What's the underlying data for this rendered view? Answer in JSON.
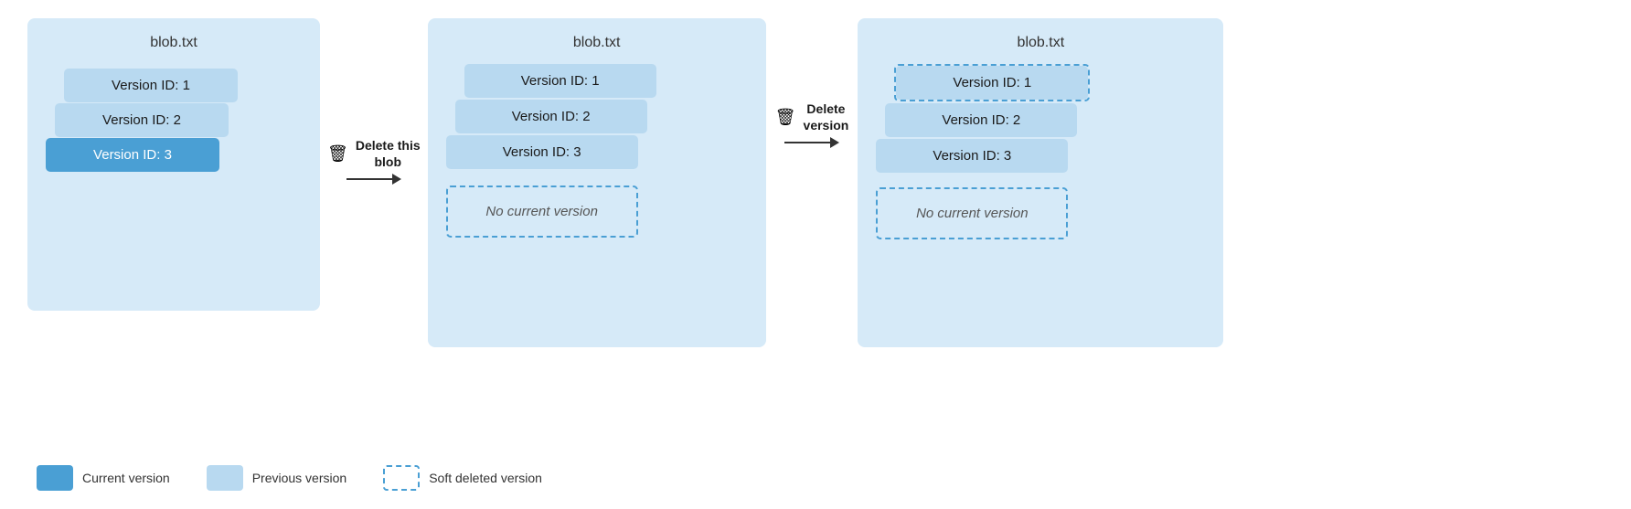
{
  "diagrams": [
    {
      "id": "diagram1",
      "title": "blob.txt",
      "versions": [
        {
          "id": "v1",
          "label": "Version ID: 1",
          "type": "previous"
        },
        {
          "id": "v2",
          "label": "Version ID: 2",
          "type": "previous"
        },
        {
          "id": "v3",
          "label": "Version ID: 3",
          "type": "current"
        }
      ]
    },
    {
      "id": "diagram2",
      "title": "blob.txt",
      "versions": [
        {
          "id": "v1",
          "label": "Version ID: 1",
          "type": "previous"
        },
        {
          "id": "v2",
          "label": "Version ID: 2",
          "type": "previous"
        },
        {
          "id": "v3",
          "label": "Version ID: 3",
          "type": "previous"
        }
      ],
      "no_current": "No current version"
    },
    {
      "id": "diagram3",
      "title": "blob.txt",
      "versions": [
        {
          "id": "v1",
          "label": "Version ID: 1",
          "type": "soft-deleted-highlighted"
        },
        {
          "id": "v2",
          "label": "Version ID: 2",
          "type": "previous"
        },
        {
          "id": "v3",
          "label": "Version ID: 3",
          "type": "previous"
        }
      ],
      "no_current": "No current version"
    }
  ],
  "actions": [
    {
      "id": "action1",
      "icon": "🗑",
      "label": "Delete this\nblob"
    },
    {
      "id": "action2",
      "icon": "🗑",
      "label": "Delete\nversion"
    }
  ],
  "legend": {
    "items": [
      {
        "type": "current",
        "label": "Current version"
      },
      {
        "type": "previous",
        "label": "Previous version"
      },
      {
        "type": "soft-deleted",
        "label": "Soft deleted version"
      }
    ]
  }
}
